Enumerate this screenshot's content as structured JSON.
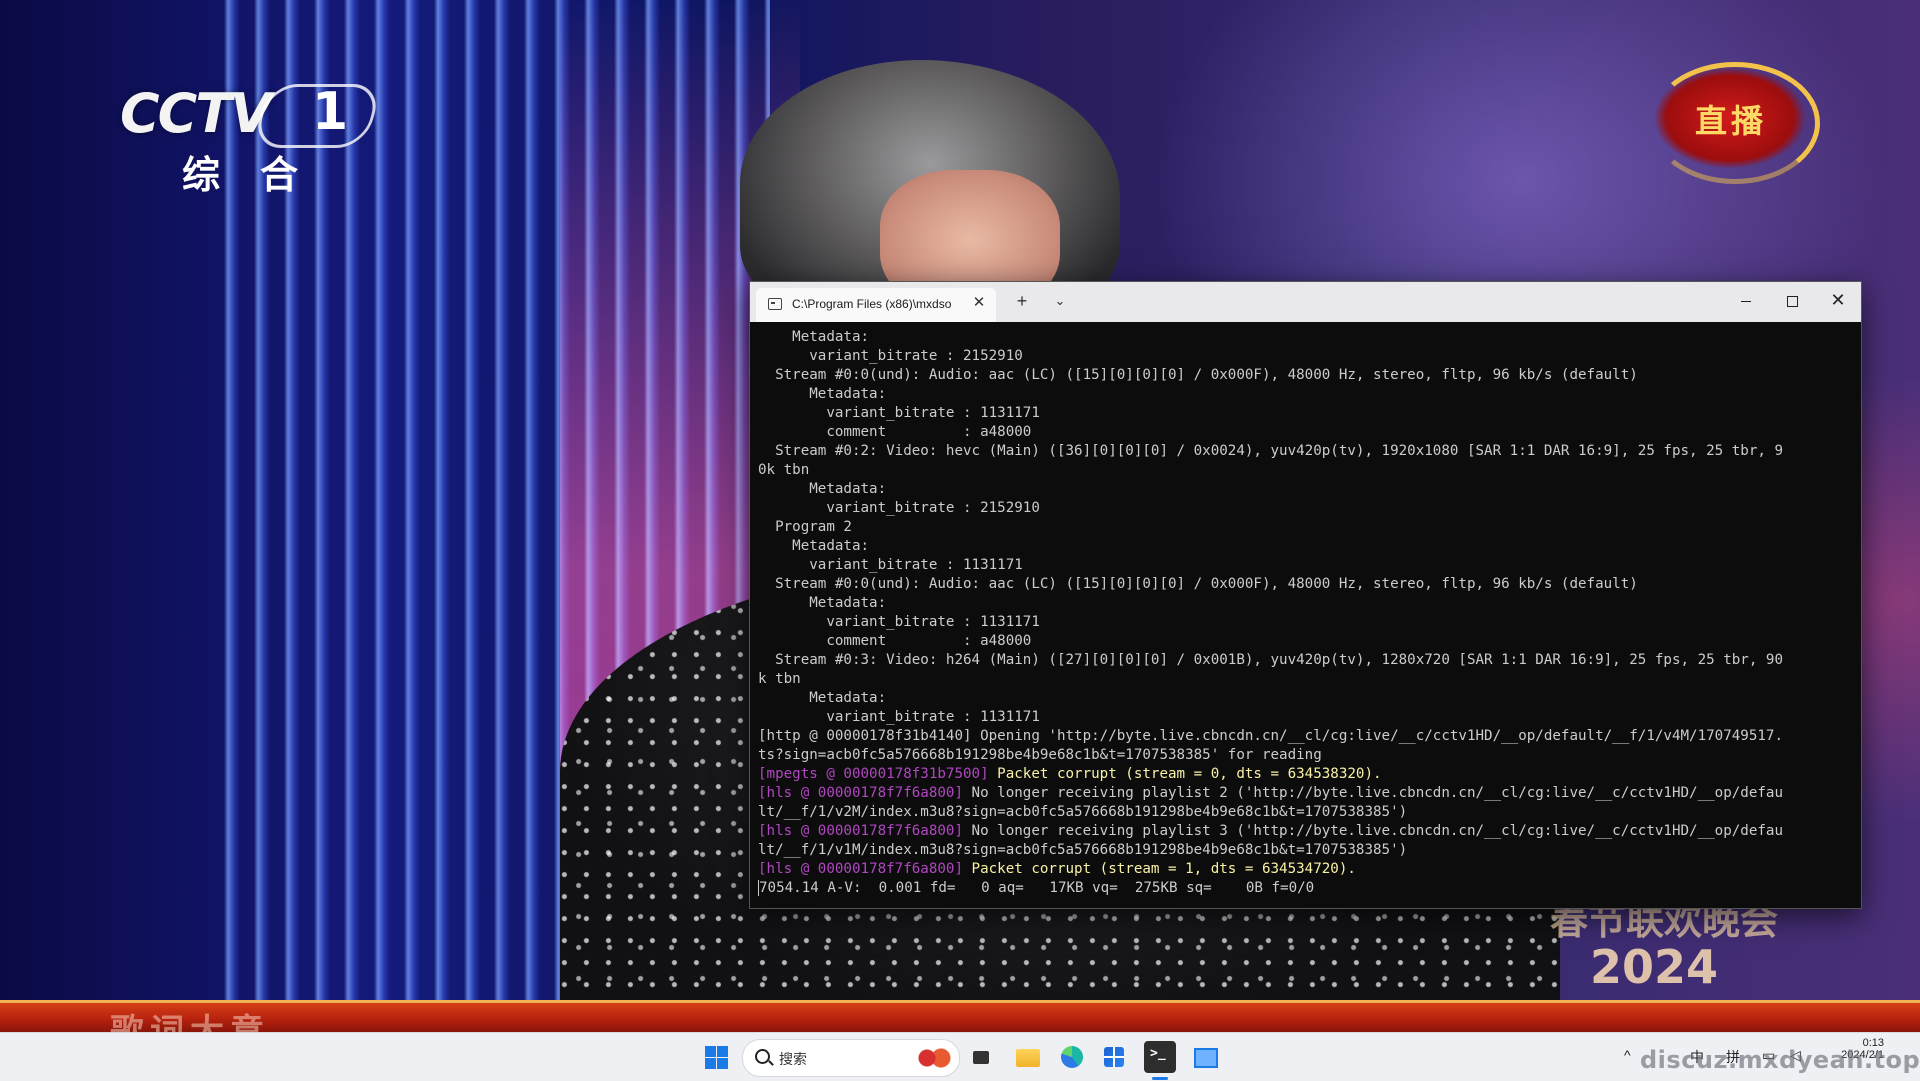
{
  "video": {
    "channel_logo": "CCTV 1",
    "channel_sub": "综合",
    "live_badge": "直播",
    "gala_title": "春节联欢晚会",
    "gala_year": "2024",
    "lyrics": "歌词大意"
  },
  "terminal": {
    "tab_title": "C:\\Program Files (x86)\\mxdso",
    "tab_close": "✕",
    "new_tab": "+",
    "tab_dropdown": "⌄",
    "close_symbol": "✕",
    "lines": [
      {
        "text": "    Metadata:"
      },
      {
        "text": "      variant_bitrate : 2152910"
      },
      {
        "text": "  Stream #0:0(und): Audio: aac (LC) ([15][0][0][0] / 0x000F), 48000 Hz, stereo, fltp, 96 kb/s (default)"
      },
      {
        "text": "      Metadata:"
      },
      {
        "text": "        variant_bitrate : 1131171"
      },
      {
        "text": "        comment         : a48000"
      },
      {
        "text": "  Stream #0:2: Video: hevc (Main) ([36][0][0][0] / 0x0024), yuv420p(tv), 1920x1080 [SAR 1:1 DAR 16:9], 25 fps, 25 tbr, 9"
      },
      {
        "text": "0k tbn"
      },
      {
        "text": "      Metadata:"
      },
      {
        "text": "        variant_bitrate : 2152910"
      },
      {
        "text": "  Program 2"
      },
      {
        "text": "    Metadata:"
      },
      {
        "text": "      variant_bitrate : 1131171"
      },
      {
        "text": "  Stream #0:0(und): Audio: aac (LC) ([15][0][0][0] / 0x000F), 48000 Hz, stereo, fltp, 96 kb/s (default)"
      },
      {
        "text": "      Metadata:"
      },
      {
        "text": "        variant_bitrate : 1131171"
      },
      {
        "text": "        comment         : a48000"
      },
      {
        "text": "  Stream #0:3: Video: h264 (Main) ([27][0][0][0] / 0x001B), yuv420p(tv), 1280x720 [SAR 1:1 DAR 16:9], 25 fps, 25 tbr, 90"
      },
      {
        "text": "k tbn"
      },
      {
        "text": "      Metadata:"
      },
      {
        "text": "        variant_bitrate : 1131171"
      },
      {
        "text": "[http @ 00000178f31b4140] Opening 'http://byte.live.cbncdn.cn/__cl/cg:live/__c/cctv1HD/__op/default/__f/1/v4M/170749517."
      },
      {
        "text": "ts?sign=acb0fc5a576668b191298be4b9e68c1b&t=1707538385' for reading"
      },
      {
        "tag": "[mpegts @ 00000178f31b7500] ",
        "tag_color": "purple",
        "text": "Packet corrupt (stream = 0, dts = 634538320).",
        "text_color": "yellow"
      },
      {
        "tag": "[hls @ 00000178f7f6a800] ",
        "tag_color": "purple",
        "text": "No longer receiving playlist 2 ('http://byte.live.cbncdn.cn/__cl/cg:live/__c/cctv1HD/__op/defau"
      },
      {
        "text": "lt/__f/1/v2M/index.m3u8?sign=acb0fc5a576668b191298be4b9e68c1b&t=1707538385')"
      },
      {
        "tag": "[hls @ 00000178f7f6a800] ",
        "tag_color": "purple",
        "text": "No longer receiving playlist 3 ('http://byte.live.cbncdn.cn/__cl/cg:live/__c/cctv1HD/__op/defau"
      },
      {
        "text": "lt/__f/1/v1M/index.m3u8?sign=acb0fc5a576668b191298be4b9e68c1b&t=1707538385')"
      },
      {
        "tag": "[hls @ 00000178f7f6a800] ",
        "tag_color": "purple",
        "text": "Packet corrupt (stream = 1, dts = 634534720).",
        "text_color": "yellow"
      },
      {
        "text": "7054.14 A-V:  0.001 fd=   0 aq=   17KB vq=  275KB sq=    0B f=0/0",
        "cursor": true
      }
    ]
  },
  "taskbar": {
    "search_placeholder": "搜索",
    "tray_chevron": "^",
    "ime_1": "中",
    "ime_2": "拼",
    "clock_time": "0:13",
    "clock_date": "2024/2/1"
  },
  "watermark": "discuz.mxdyeah.top",
  "colors": {
    "terminal_bg": "#0c0c0c",
    "terminal_text": "#cccccc",
    "tag_purple": "#b146c2",
    "warn_yellow": "#f9f1a5",
    "accent_blue": "#1a7ae6"
  }
}
